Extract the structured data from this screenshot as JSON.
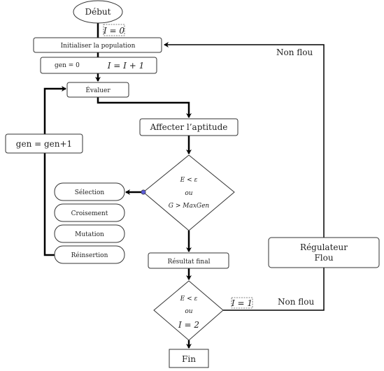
{
  "nodes": {
    "start": "Début",
    "init_flag": "I = 0",
    "init_population": "Initialiser la population",
    "gen_zero": "gen = 0",
    "increment": "I = I + 1",
    "evaluate": "Évaluer",
    "fitness": "Affecter l’aptitude",
    "loop_label": "gen = gen+1",
    "condition1": {
      "line1": "E < ε",
      "line2": "ou",
      "line3": "G > MaxGen"
    },
    "operators": [
      "Sélection",
      "Croisement",
      "Mutation",
      "Réinsertion"
    ],
    "final_result": "Résultat final",
    "condition2": {
      "line1": "E < ε",
      "line2": "ou",
      "line3": "I = 2"
    },
    "flag_one": "I = 1",
    "non_fuzzy_bottom": "Non flou",
    "fuzzy_regulator": {
      "line1": "Régulateur",
      "line2": "Flou"
    },
    "non_fuzzy_top": "Non flou",
    "end": "Fin"
  },
  "colors": {
    "connector_dot": "#5b5bd6"
  }
}
